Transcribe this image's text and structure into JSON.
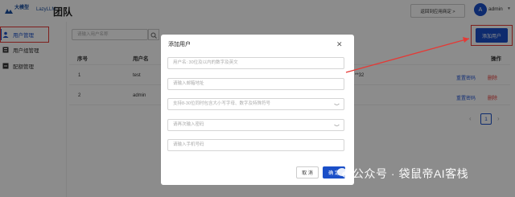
{
  "header": {
    "logo_cn": "大模型",
    "logo_en": "LazyLLM",
    "title": "团队",
    "return_button": "返回到应用商定 >",
    "avatar_letter": "A",
    "user": "admin"
  },
  "sidebar": {
    "items": [
      {
        "label": "用户管理",
        "active": true
      },
      {
        "label": "用户组管理",
        "active": false
      },
      {
        "label": "配额管理",
        "active": false
      }
    ]
  },
  "search": {
    "placeholder": "请输入用户名称"
  },
  "toolbar": {
    "add_user": "添加用户"
  },
  "table": {
    "columns": [
      "序号",
      "用户名",
      "操作"
    ],
    "rows": [
      {
        "index": "1",
        "username": "test",
        "masked": "**32",
        "reset": "重置密码",
        "delete": "删除"
      },
      {
        "index": "2",
        "username": "admin",
        "reset": "重置密码",
        "delete": "删除"
      }
    ]
  },
  "pagination": {
    "prev": "‹",
    "current": "1",
    "next": "›"
  },
  "modal": {
    "title": "添加用户",
    "fields": [
      {
        "placeholder": "用户名: 30位及以内的数字及英文",
        "eye": false
      },
      {
        "placeholder": "请输入邮箱地址",
        "eye": false
      },
      {
        "placeholder": "支持8-30位同时包含大小写字母、数字及特殊符号",
        "eye": true
      },
      {
        "placeholder": "请再次输入密码",
        "eye": true
      },
      {
        "placeholder": "请输入手机号码",
        "eye": false
      }
    ],
    "cancel": "取 消",
    "confirm": "确 定"
  },
  "watermark": "公众号 · 袋鼠帝AI客栈",
  "colors": {
    "primary": "#1a4fc8",
    "danger": "#e53935",
    "annotation": "#e53935"
  }
}
